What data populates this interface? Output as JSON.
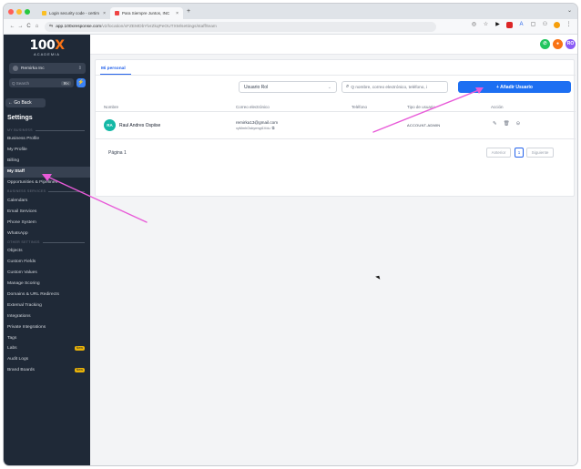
{
  "browser": {
    "tabs": [
      {
        "title": "Login security code - certim",
        "active": false
      },
      {
        "title": "Para Siempre Juntos, INC",
        "active": true
      }
    ],
    "url_host": "app.100xresponse.com",
    "url_path": "/v2/location/xFZEMDbYlvrZkqPeOUTXM/settings/staff/team"
  },
  "sidebar": {
    "logo_main": "100",
    "logo_x": "X",
    "logo_sub": "ACADEMIA",
    "account": "Remirka Inc",
    "search_placeholder": "Q Search",
    "search_kbd": "⌘K",
    "go_back": "← Go Back",
    "settings_title": "Settings",
    "items": [
      {
        "type": "section",
        "label": "MY BUSINESS"
      },
      {
        "type": "item",
        "label": "Business Profile"
      },
      {
        "type": "item",
        "label": "My Profile"
      },
      {
        "type": "item",
        "label": "Billing"
      },
      {
        "type": "item",
        "label": "My Staff",
        "active": true
      },
      {
        "type": "item",
        "label": "Opportunities & Pipelines"
      },
      {
        "type": "section",
        "label": "BUSINESS SERVICES"
      },
      {
        "type": "item",
        "label": "Calendars"
      },
      {
        "type": "item",
        "label": "Email Services"
      },
      {
        "type": "item",
        "label": "Phone System"
      },
      {
        "type": "item",
        "label": "WhatsApp"
      },
      {
        "type": "section",
        "label": "OTHER SETTINGS"
      },
      {
        "type": "item",
        "label": "Objects"
      },
      {
        "type": "item",
        "label": "Custom Fields"
      },
      {
        "type": "item",
        "label": "Custom Values"
      },
      {
        "type": "item",
        "label": "Manage Scoring"
      },
      {
        "type": "item",
        "label": "Domains & URL Redirects"
      },
      {
        "type": "item",
        "label": "External Tracking"
      },
      {
        "type": "item",
        "label": "Integrations"
      },
      {
        "type": "item",
        "label": "Private Integrations"
      },
      {
        "type": "item",
        "label": "Tags"
      },
      {
        "type": "item",
        "label": "Labs",
        "badge": "New"
      },
      {
        "type": "item",
        "label": "Audit Logs"
      },
      {
        "type": "item",
        "label": "Brand Boards",
        "badge": "New"
      }
    ]
  },
  "topbar": {
    "icons": [
      {
        "name": "phone-icon",
        "color": "#22c55e",
        "label": "✆"
      },
      {
        "name": "notification-icon",
        "color": "#f97316",
        "label": "●"
      },
      {
        "name": "user-avatar-icon",
        "color": "#8b5cf6",
        "label": "RO"
      }
    ]
  },
  "main": {
    "tab_label": "Mi personal",
    "role_select": "Usuario Rol",
    "search_placeholder": "Q nombre, correo electrónico, teléfono, i",
    "add_button": "+ Añadir Usuario",
    "columns": [
      "Nombre",
      "Correo electrónico",
      "Teléfono",
      "Tipo de usuario",
      "Acción"
    ],
    "rows": [
      {
        "initials": "RA",
        "name": "Raul Andres Ospiise",
        "email": "remirka13@gmail.com",
        "uid": "xyMmhOsbyrmgt1Vdu",
        "phone": "",
        "type": "ACCOUNT-ADMIN"
      }
    ],
    "pagination": {
      "label": "Página 1",
      "prev": "Anterior",
      "page": "1",
      "next": "Siguiente"
    }
  },
  "colors": {
    "annotation_arrow": "#e85ad8",
    "accent": "#1d6ff2",
    "sidebar_bg": "#1f2937"
  }
}
